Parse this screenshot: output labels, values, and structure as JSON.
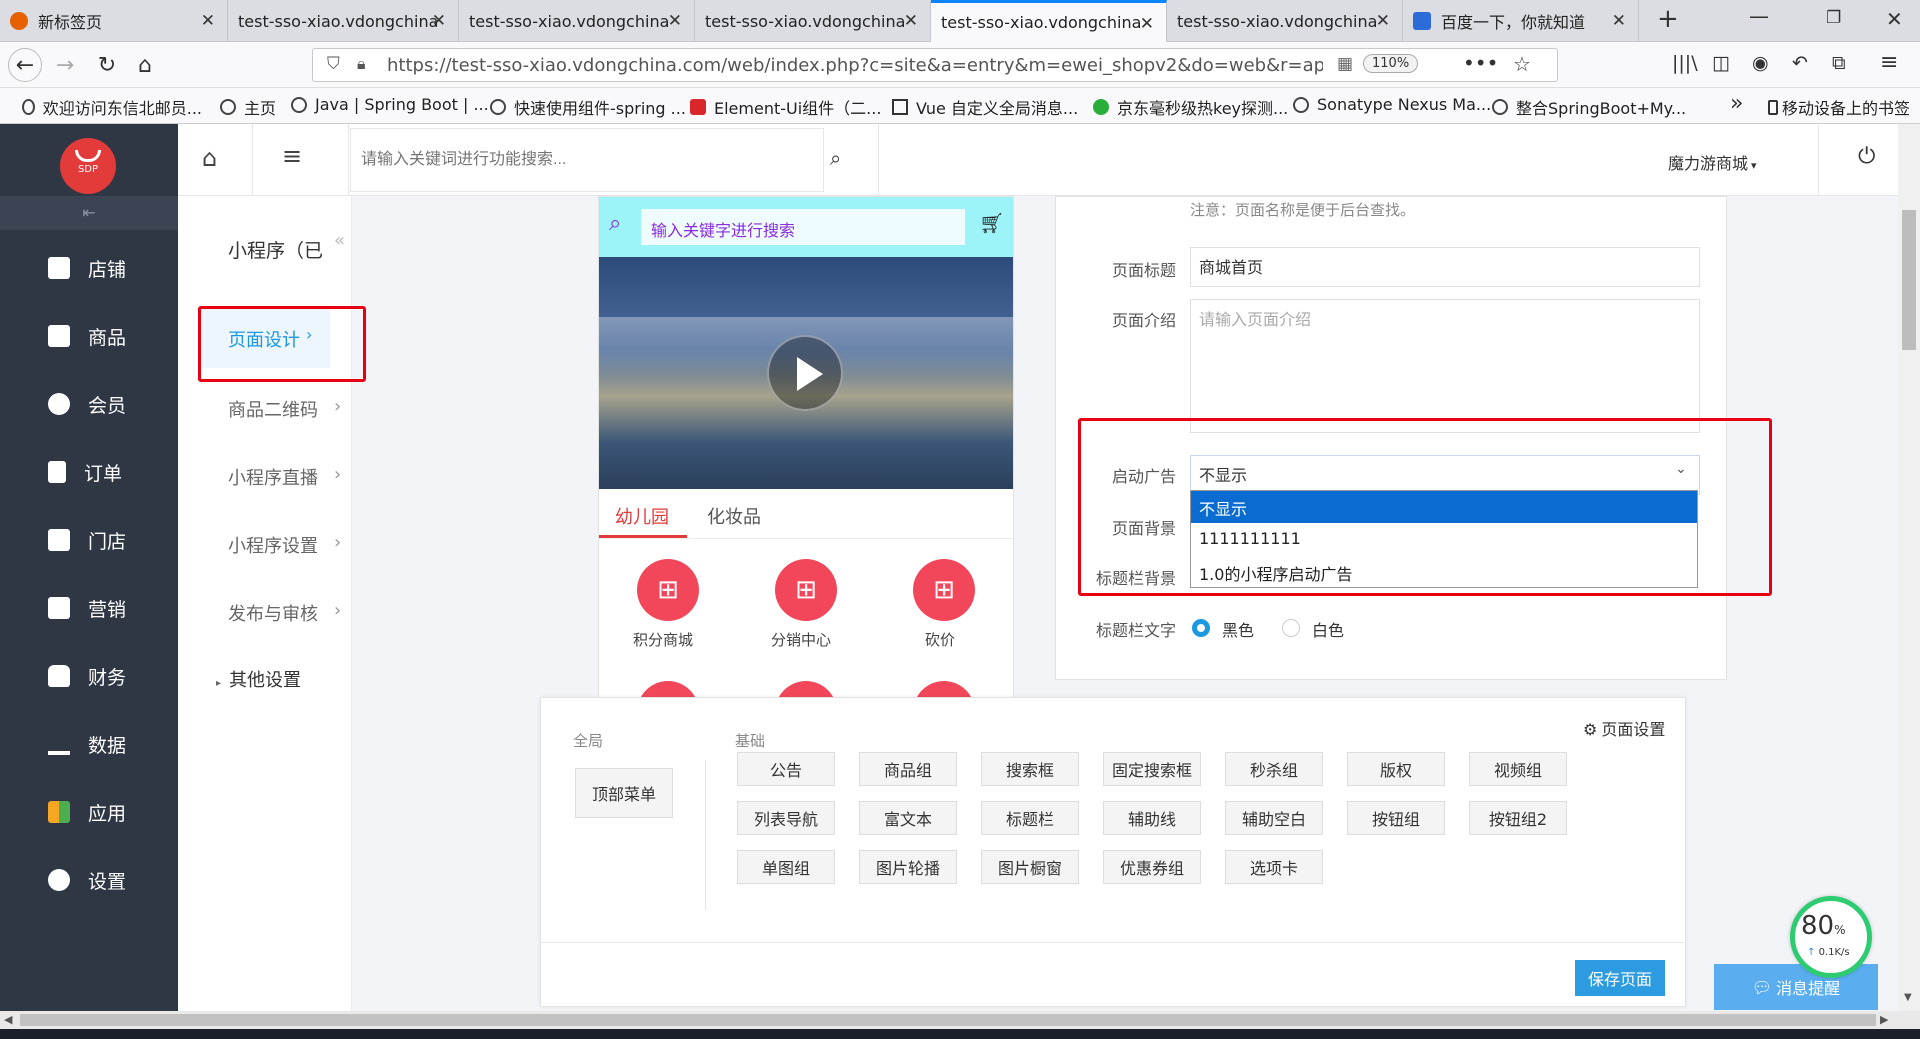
{
  "browser": {
    "tabs": [
      {
        "label": "新标签页",
        "active": false
      },
      {
        "label": "test-sso-xiao.vdongchina.c",
        "active": false
      },
      {
        "label": "test-sso-xiao.vdongchina.c",
        "active": false
      },
      {
        "label": "test-sso-xiao.vdongchina.c",
        "active": false
      },
      {
        "label": "test-sso-xiao.vdongchina.c",
        "active": true
      },
      {
        "label": "test-sso-xiao.vdongchina.c",
        "active": false
      },
      {
        "label": "百度一下，你就知道",
        "active": false
      }
    ],
    "url": "https://test-sso-xiao.vdongchina.com/web/index.php?c=site&a=entry&m=ewei_shopv2&do=web&r=app.page.ed",
    "zoom": "110%",
    "bookmarks": [
      "欢迎访问东信北邮员...",
      "主页",
      "Java | Spring Boot | ...",
      "快速使用组件-spring ...",
      "Element-Ui组件（二...",
      "Vue 自定义全局消息...",
      "京东毫秒级热key探测...",
      "Sonatype Nexus Ma...",
      "整合SpringBoot+My..."
    ],
    "mobile_bookmarks": "移动设备上的书签"
  },
  "sidebar": {
    "logo_text": "SDP",
    "items": [
      "店铺",
      "商品",
      "会员",
      "订单",
      "门店",
      "营销",
      "财务",
      "数据",
      "应用",
      "设置"
    ]
  },
  "header": {
    "search_placeholder": "请输入关键词进行功能搜索...",
    "shop_name": "魔力游商城"
  },
  "submenu": {
    "title": "小程序（已",
    "items": [
      "页面设计",
      "商品二维码",
      "小程序直播",
      "小程序设置",
      "发布与审核"
    ],
    "other": "其他设置"
  },
  "phone": {
    "search_placeholder": "输入关键字进行搜索",
    "tabs": [
      "幼儿园",
      "化妆品"
    ],
    "icons": [
      "积分商城",
      "分销中心",
      "砍价"
    ]
  },
  "form": {
    "note": "注意：页面名称是便于后台查找。",
    "title_label": "页面标题",
    "title_value": "商城首页",
    "intro_label": "页面介绍",
    "intro_placeholder": "请输入页面介绍",
    "ad_label": "启动广告",
    "ad_selected": "不显示",
    "ad_options": [
      "不显示",
      "1111111111",
      "1.0的小程序启动广告"
    ],
    "bg_label": "页面背景",
    "titlebar_bg_label": "标题栏背景",
    "titlebar_text_label": "标题栏文字",
    "titlebar_text_options": [
      "黑色",
      "白色"
    ]
  },
  "widgets": {
    "global_label": "全局",
    "basic_label": "基础",
    "page_settings": "页面设置",
    "global_items": [
      "顶部菜单"
    ],
    "basic_items": [
      "公告",
      "商品组",
      "搜索框",
      "固定搜索框",
      "秒杀组",
      "版权",
      "视频组",
      "列表导航",
      "富文本",
      "标题栏",
      "辅助线",
      "辅助空白",
      "按钮组",
      "按钮组2",
      "单图组",
      "图片轮播",
      "图片橱窗",
      "优惠券组",
      "选项卡"
    ],
    "save_button": "保存页面"
  },
  "status": {
    "percent": "80",
    "percent_sign": "%",
    "speed": "0.1K/s",
    "message": "消息提醒"
  },
  "colors": {
    "accent": "#1c98e0",
    "sidebar": "#2f3744",
    "red": "#e33a3a",
    "highlight": "#e60012"
  }
}
